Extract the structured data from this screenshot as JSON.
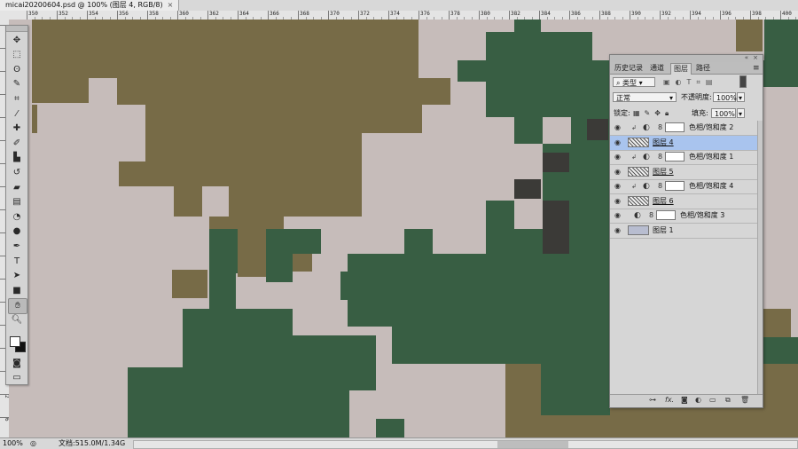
{
  "document": {
    "tab_title": "micai20200604.psd @ 100% (图层 4, RGB/8)",
    "close_symbol": "×"
  },
  "ruler_top": [
    "350",
    "352",
    "354",
    "356",
    "358",
    "360",
    "362",
    "364",
    "366",
    "368",
    "370",
    "372",
    "374",
    "376",
    "378",
    "380",
    "382",
    "384",
    "386",
    "388",
    "390",
    "392",
    "394",
    "396",
    "398",
    "400"
  ],
  "ruler_left": [
    "8",
    "1",
    "1",
    "2",
    "1",
    "4",
    "1",
    "6",
    "1",
    "8",
    "2",
    "0",
    "2",
    "2",
    "2",
    "4",
    "2",
    "6"
  ],
  "colors": {
    "canvas_pink": "#c6bcba",
    "olive": "#776b47",
    "green": "#385e43",
    "dark_gray": "#3b3a37",
    "panel_bg": "#d6d6d6",
    "selected_layer": "#a9c4ee"
  },
  "toolbar": {
    "tools": [
      "move-icon",
      "marquee-icon",
      "lasso-icon",
      "quick-select-icon",
      "crop-icon",
      "eyedropper-icon",
      "healing-icon",
      "brush-icon",
      "stamp-icon",
      "history-brush-icon",
      "eraser-icon",
      "gradient-icon",
      "blur-icon",
      "dodge-icon",
      "pen-icon",
      "type-icon",
      "path-select-icon",
      "shape-icon",
      "hand-icon",
      "zoom-icon"
    ],
    "active_tool": "hand-icon"
  },
  "status": {
    "zoom": "100%",
    "doc_info": "文档:515.0M/1.34G"
  },
  "layers_panel": {
    "tabs": [
      "历史记录",
      "通道",
      "图层",
      "路径"
    ],
    "active_tab": "图层",
    "filter_kind": "类型",
    "blend_mode": "正常",
    "opacity_label": "不透明度:",
    "opacity_value": "100%",
    "lock_label": "锁定:",
    "fill_label": "填充:",
    "fill_value": "100%",
    "layers": [
      {
        "name": "色相/饱和度 2",
        "type": "adjustment",
        "clipped": true,
        "selected": false
      },
      {
        "name": "图层 4",
        "type": "pixel",
        "clipped": false,
        "selected": true
      },
      {
        "name": "色相/饱和度 1",
        "type": "adjustment",
        "clipped": true,
        "selected": false
      },
      {
        "name": "图层 5",
        "type": "pixel",
        "clipped": false,
        "selected": false
      },
      {
        "name": "色相/饱和度 4",
        "type": "adjustment",
        "clipped": true,
        "selected": false
      },
      {
        "name": "图层 6",
        "type": "pixel",
        "clipped": false,
        "selected": false
      },
      {
        "name": "色相/饱和度 3",
        "type": "adjustment",
        "clipped": false,
        "selected": false
      },
      {
        "name": "图层 1",
        "type": "fill",
        "clipped": false,
        "selected": false
      }
    ],
    "footer_icons": [
      "link-icon",
      "fx-icon",
      "mask-icon",
      "adjustment-icon",
      "folder-icon",
      "new-layer-icon",
      "trash-icon"
    ]
  }
}
